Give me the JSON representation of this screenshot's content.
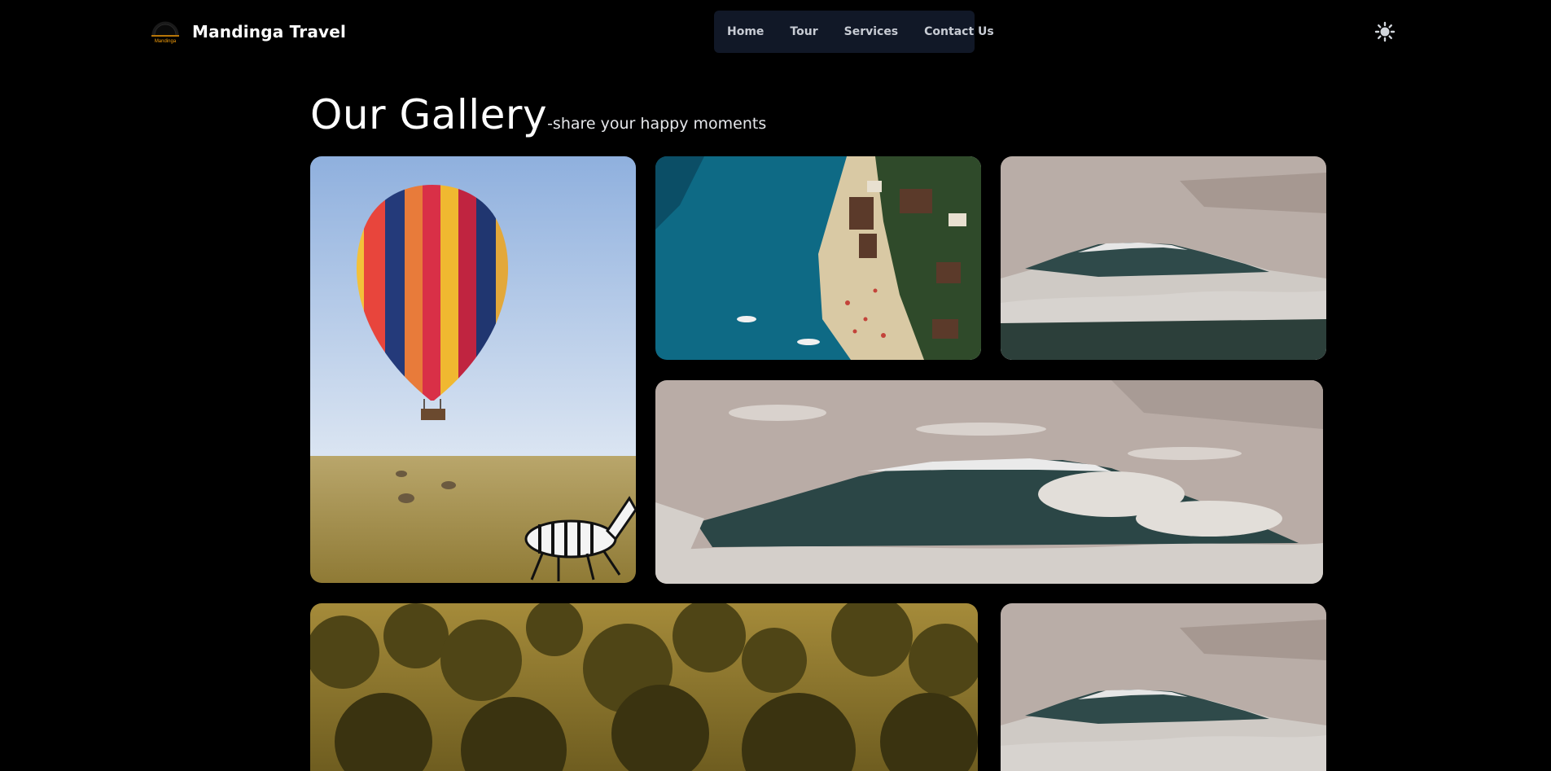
{
  "brand": {
    "name": "Mandinga Travel",
    "logo_text": "Mandinga"
  },
  "nav": {
    "items": [
      "Home",
      "Tour",
      "Services",
      "Contact Us"
    ]
  },
  "theme_toggle": {
    "icon": "sun-icon"
  },
  "gallery": {
    "title": "Our Gallery",
    "subtitle": "-share your happy moments"
  },
  "colors": {
    "background": "#000000",
    "nav_bg": "#111827",
    "text": "#ffffff",
    "logo_accent": "#f59e0b"
  }
}
